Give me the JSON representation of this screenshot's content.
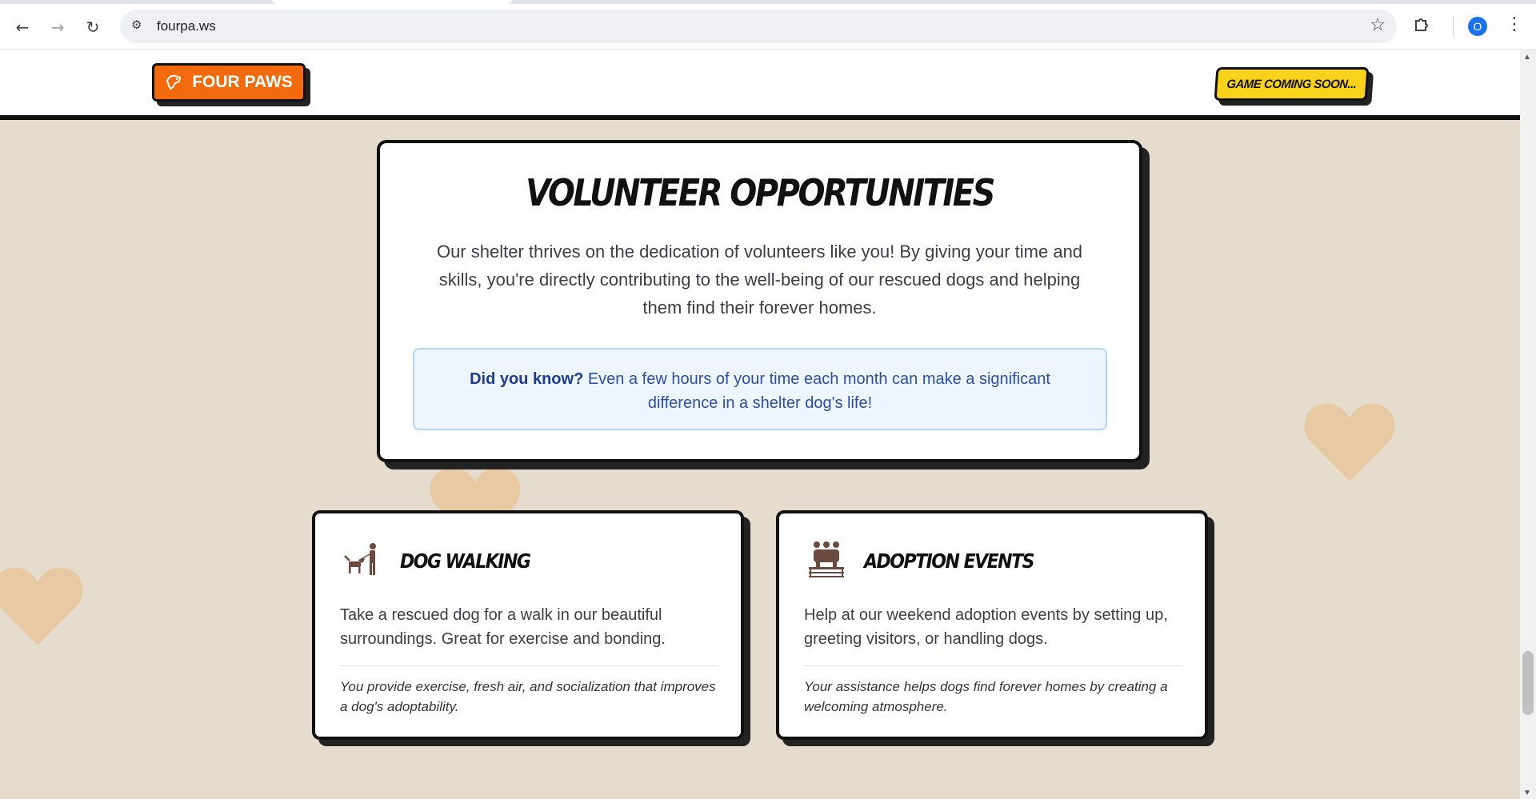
{
  "browser": {
    "url": "fourpa.ws",
    "profile_initial": "O",
    "icons": {
      "back": "back-arrow-icon",
      "forward": "forward-arrow-icon",
      "reload": "reload-icon",
      "site_info": "tune-icon",
      "bookmark": "star-icon",
      "extensions": "puzzle-icon",
      "menu": "kebab-menu-icon"
    }
  },
  "header": {
    "logo_label": "FOUR PAWS",
    "logo_icon": "paw-icon",
    "game_label": "GAME COMING SOON...",
    "colors": {
      "logo_bg": "#f26a0c",
      "game_bg": "#f8d21b"
    }
  },
  "volunteer": {
    "title": "VOLUNTEER OPPORTUNITIES",
    "intro": "Our shelter thrives on the dedication of volunteers like you! By giving your time and skills, you're directly contributing to the well-being of our rescued dogs and helping them find their forever homes.",
    "did_you_know_label": "Did you know?",
    "did_you_know_text": " Even a few hours of your time each month can make a significant difference in a shelter dog's life!"
  },
  "opportunities": [
    {
      "icon": "dog-walking-icon",
      "title": "DOG WALKING",
      "description": "Take a rescued dog for a walk in our beautiful surroundings. Great for exercise and bonding.",
      "impact": "You provide exercise, fresh air, and socialization that improves a dog's adoptability."
    },
    {
      "icon": "adoption-event-icon",
      "title": "ADOPTION EVENTS",
      "description": "Help at our weekend adoption events by setting up, greeting visitors, or handling dogs.",
      "impact": "Your assistance helps dogs find forever homes by creating a welcoming atmosphere."
    }
  ],
  "decorations": {
    "heart_color": "#e8c9a0"
  }
}
